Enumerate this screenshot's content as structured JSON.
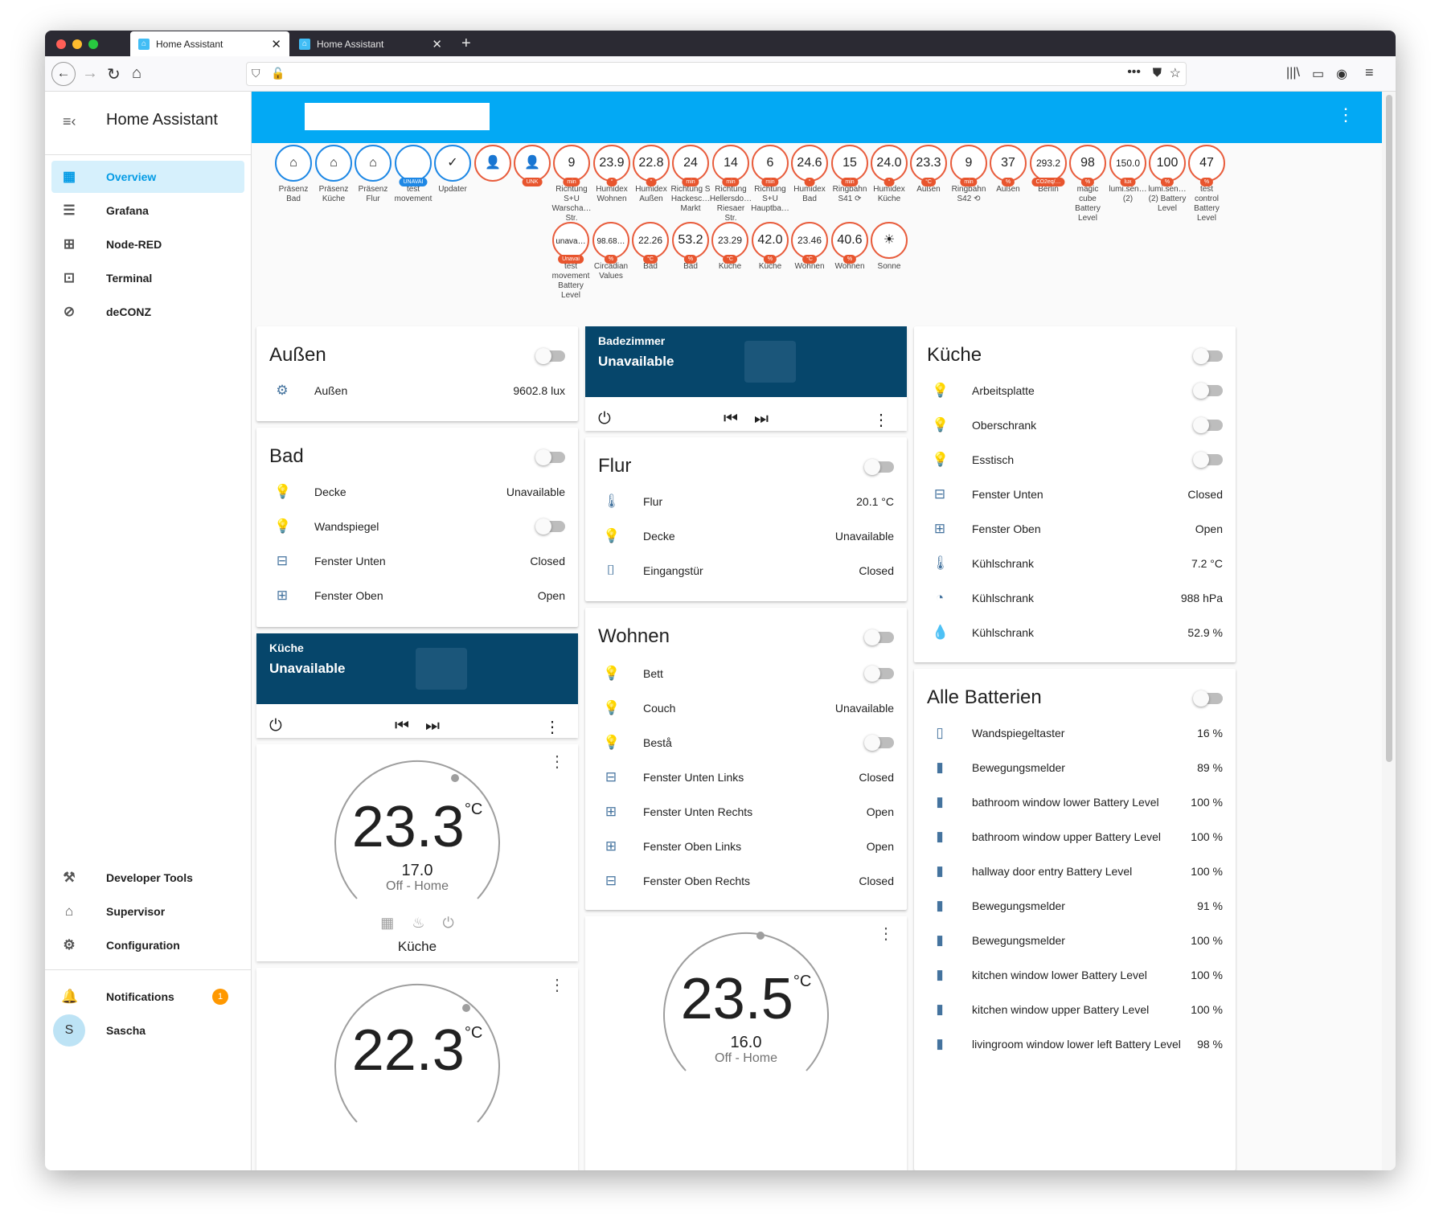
{
  "browser": {
    "tabs": [
      {
        "title": "Home Assistant",
        "active": true
      },
      {
        "title": "Home Assistant",
        "active": false
      }
    ],
    "new_tab": "+"
  },
  "sidebar": {
    "title": "Home Assistant",
    "items": [
      {
        "label": "Overview",
        "icon": "grid-icon",
        "selected": true
      },
      {
        "label": "Grafana",
        "icon": "chart-icon"
      },
      {
        "label": "Node-RED",
        "icon": "sitemap-icon"
      },
      {
        "label": "Terminal",
        "icon": "terminal-icon"
      },
      {
        "label": "deCONZ",
        "icon": "zigbee-icon"
      }
    ],
    "bottom_items": [
      {
        "label": "Developer Tools",
        "icon": "hammer-icon"
      },
      {
        "label": "Supervisor",
        "icon": "home-assistant-icon"
      },
      {
        "label": "Configuration",
        "icon": "gear-icon"
      }
    ],
    "notifications": {
      "label": "Notifications",
      "count": "1"
    },
    "user": {
      "label": "Sascha",
      "initial": "S"
    }
  },
  "badges": [
    {
      "value": "⌂",
      "label": "Präsenz\nBad",
      "color": "blue"
    },
    {
      "value": "⌂",
      "label": "Präsenz\nKüche",
      "color": "blue"
    },
    {
      "value": "⌂",
      "label": "Präsenz\nFlur",
      "color": "blue"
    },
    {
      "value": "",
      "unit": "UNAVAI",
      "label": "test\nmovement",
      "color": "blue"
    },
    {
      "value": "✓",
      "label": "Updater",
      "color": "blue"
    },
    {
      "value": "👤",
      "label": "",
      "color": "red"
    },
    {
      "value": "👤",
      "unit": "UNK",
      "label": "",
      "color": "red"
    },
    {
      "value": "9",
      "unit": "min",
      "label": "Richtung\nS+U\nWarscha…\nStr.",
      "color": "red"
    },
    {
      "value": "23.9",
      "unit": "°",
      "label": "Humidex\nWohnen",
      "color": "red"
    },
    {
      "value": "22.8",
      "unit": "°",
      "label": "Humidex\nAußen",
      "color": "red"
    },
    {
      "value": "24",
      "unit": "min",
      "label": "Richtung S\nHackesc…\nMarkt",
      "color": "red"
    },
    {
      "value": "14",
      "unit": "min",
      "label": "Richtung\nHellersdo…\nRiesaer\nStr.",
      "color": "red"
    },
    {
      "value": "6",
      "unit": "min",
      "label": "Richtung\nS+U\nHauptba…",
      "color": "red"
    },
    {
      "value": "24.6",
      "unit": "°",
      "label": "Humidex\nBad",
      "color": "red"
    },
    {
      "value": "15",
      "unit": "min",
      "label": "Ringbahn\nS41 ⟳",
      "color": "red"
    },
    {
      "value": "24.0",
      "unit": "°",
      "label": "Humidex\nKüche",
      "color": "red"
    },
    {
      "value": "23.3",
      "unit": "°C",
      "label": "Außen",
      "color": "red"
    },
    {
      "value": "9",
      "unit": "min",
      "label": "Ringbahn\nS42 ⟲",
      "color": "red"
    },
    {
      "value": "37",
      "unit": "%",
      "label": "Außen",
      "color": "red"
    },
    {
      "value": "293.2",
      "unit": "CO2eq/…",
      "label": "Berlin",
      "color": "red",
      "small": true
    },
    {
      "value": "98",
      "unit": "%",
      "label": "magic\ncube\nBattery\nLevel",
      "color": "red"
    },
    {
      "value": "150.0",
      "unit": "lux",
      "label": "lumi.sen…\n(2)",
      "color": "red",
      "small": true
    },
    {
      "value": "100",
      "unit": "%",
      "label": "lumi.sen…\n(2) Battery\nLevel",
      "color": "red"
    },
    {
      "value": "47",
      "unit": "%",
      "label": "test\ncontrol\nBattery\nLevel",
      "color": "red"
    },
    {
      "value": "unava…",
      "unit": "Unavai",
      "label": "test\nmovement\nBattery\nLevel",
      "color": "red",
      "small": true
    },
    {
      "value": "98.68…",
      "unit": "%",
      "label": "Circadian\nValues",
      "color": "red",
      "small": true
    },
    {
      "value": "22.26",
      "unit": "°C",
      "label": "Bad",
      "color": "red",
      "small": true
    },
    {
      "value": "53.2",
      "unit": "%",
      "label": "Bad",
      "color": "red"
    },
    {
      "value": "23.29",
      "unit": "°C",
      "label": "Küche",
      "color": "red",
      "small": true
    },
    {
      "value": "42.0",
      "unit": "%",
      "label": "Küche",
      "color": "red"
    },
    {
      "value": "23.46",
      "unit": "°C",
      "label": "Wohnen",
      "color": "red",
      "small": true
    },
    {
      "value": "40.6",
      "unit": "%",
      "label": "Wohnen",
      "color": "red"
    },
    {
      "value": "☀",
      "label": "Sonne",
      "color": "red"
    }
  ],
  "cards": {
    "aussen": {
      "title": "Außen",
      "rows": [
        {
          "name": "Außen",
          "value": "9602.8 lux",
          "icon": "sun-icon"
        }
      ]
    },
    "bad": {
      "title": "Bad",
      "rows": [
        {
          "name": "Decke",
          "value": "Unavailable",
          "icon": "bulb-off-icon"
        },
        {
          "name": "Wandspiegel",
          "toggle": true,
          "icon": "bulb-icon"
        },
        {
          "name": "Fenster Unten",
          "value": "Closed",
          "icon": "window-icon"
        },
        {
          "name": "Fenster Oben",
          "value": "Open",
          "icon": "window-open-icon"
        }
      ]
    },
    "media_kueche": {
      "title": "Küche",
      "state": "Unavailable"
    },
    "media_bad": {
      "title": "Badezimmer",
      "state": "Unavailable"
    },
    "flur": {
      "title": "Flur",
      "rows": [
        {
          "name": "Flur",
          "value": "20.1 °C",
          "icon": "thermometer-icon"
        },
        {
          "name": "Decke",
          "value": "Unavailable",
          "icon": "bulb-off-icon"
        },
        {
          "name": "Eingangstür",
          "value": "Closed",
          "icon": "door-icon"
        }
      ]
    },
    "wohnen": {
      "title": "Wohnen",
      "rows": [
        {
          "name": "Bett",
          "toggle": true,
          "icon": "bulb-icon"
        },
        {
          "name": "Couch",
          "value": "Unavailable",
          "icon": "bulb-off-icon"
        },
        {
          "name": "Bestå",
          "toggle": true,
          "icon": "bulb-icon"
        },
        {
          "name": "Fenster Unten Links",
          "value": "Closed",
          "icon": "window-icon"
        },
        {
          "name": "Fenster Unten Rechts",
          "value": "Open",
          "icon": "window-open-icon"
        },
        {
          "name": "Fenster Oben Links",
          "value": "Open",
          "icon": "window-open-icon"
        },
        {
          "name": "Fenster Oben Rechts",
          "value": "Closed",
          "icon": "window-icon"
        }
      ]
    },
    "kueche": {
      "title": "Küche",
      "rows": [
        {
          "name": "Arbeitsplatte",
          "toggle": true,
          "icon": "bulb-icon"
        },
        {
          "name": "Oberschrank",
          "toggle": true,
          "icon": "bulb-icon"
        },
        {
          "name": "Esstisch",
          "toggle": true,
          "icon": "bulb-icon"
        },
        {
          "name": "Fenster Unten",
          "value": "Closed",
          "icon": "window-icon"
        },
        {
          "name": "Fenster Oben",
          "value": "Open",
          "icon": "window-open-icon"
        },
        {
          "name": "Kühlschrank",
          "value": "7.2 °C",
          "icon": "thermometer-icon"
        },
        {
          "name": "Kühlschrank",
          "value": "988 hPa",
          "icon": "gauge-icon"
        },
        {
          "name": "Kühlschrank",
          "value": "52.9 %",
          "icon": "water-percent-icon"
        }
      ]
    },
    "batterien": {
      "title": "Alle Batterien",
      "rows": [
        {
          "name": "Wandspiegeltaster",
          "value": "16 %",
          "icon": "battery-low-icon"
        },
        {
          "name": "Bewegungsmelder",
          "value": "89 %",
          "icon": "battery-icon"
        },
        {
          "name": "bathroom window lower Battery Level",
          "value": "100 %",
          "icon": "battery-icon"
        },
        {
          "name": "bathroom window upper Battery Level",
          "value": "100 %",
          "icon": "battery-icon"
        },
        {
          "name": "hallway door entry Battery Level",
          "value": "100 %",
          "icon": "battery-icon"
        },
        {
          "name": "Bewegungsmelder",
          "value": "91 %",
          "icon": "battery-icon"
        },
        {
          "name": "Bewegungsmelder",
          "value": "100 %",
          "icon": "battery-icon"
        },
        {
          "name": "kitchen window lower Battery Level",
          "value": "100 %",
          "icon": "battery-icon"
        },
        {
          "name": "kitchen window upper Battery Level",
          "value": "100 %",
          "icon": "battery-icon"
        },
        {
          "name": "livingroom window lower left Battery Level",
          "value": "98 %",
          "icon": "battery-icon"
        }
      ]
    }
  },
  "thermostats": [
    {
      "current": "23.3",
      "unit": "°C",
      "target": "17.0",
      "mode": "Off - Home",
      "name": "Küche"
    },
    {
      "current": "22.3",
      "unit": "°C"
    },
    {
      "current": "23.5",
      "unit": "°C",
      "target": "16.0",
      "mode": "Off - Home"
    }
  ]
}
